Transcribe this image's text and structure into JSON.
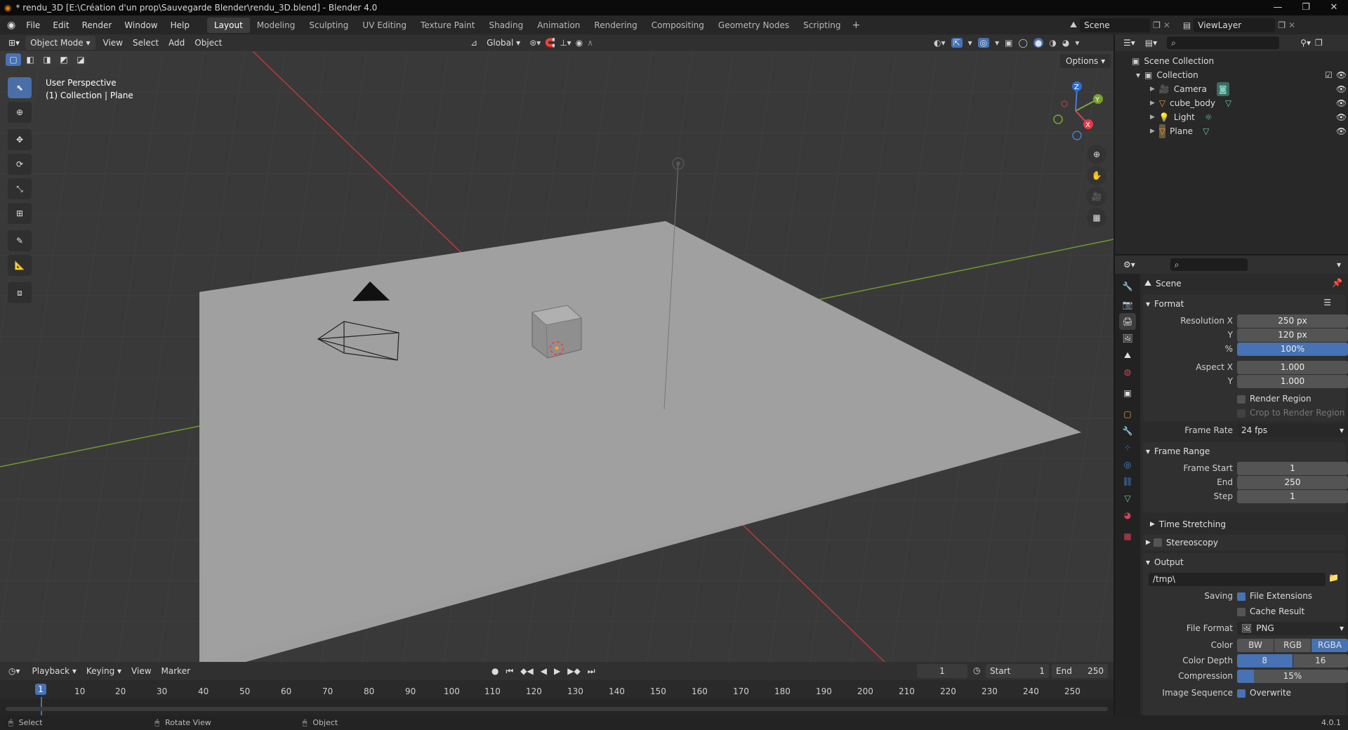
{
  "window": {
    "title": "* rendu_3D [E:\\Création d'un prop\\Sauvegarde Blender\\rendu_3D.blend] - Blender 4.0"
  },
  "topbar": {
    "menus": [
      "File",
      "Edit",
      "Render",
      "Window",
      "Help"
    ],
    "workspaces": [
      "Layout",
      "Modeling",
      "Sculpting",
      "UV Editing",
      "Texture Paint",
      "Shading",
      "Animation",
      "Rendering",
      "Compositing",
      "Geometry Nodes",
      "Scripting"
    ],
    "active_workspace": "Layout",
    "scene": "Scene",
    "view_layer": "ViewLayer"
  },
  "viewport_header": {
    "mode": "Object Mode",
    "menus": [
      "View",
      "Select",
      "Add",
      "Object"
    ],
    "orientation": "Global",
    "options": "Options"
  },
  "viewport": {
    "perspective": "User Perspective",
    "collection_info": "(1) Collection | Plane",
    "axes": {
      "z": "Z",
      "y": "Y",
      "x": "X"
    },
    "colors": {
      "x_axis": "#b83b3b",
      "y_axis": "#6e9b2d",
      "plane": "#9e9e9e",
      "bg": "#393939",
      "accent": "#4772b3"
    }
  },
  "timeline": {
    "menus": [
      "Playback",
      "Keying",
      "View",
      "Marker"
    ],
    "current_frame": "1",
    "start_label": "Start",
    "start": "1",
    "end_label": "End",
    "end": "250",
    "ruler": [
      "1",
      "10",
      "20",
      "30",
      "40",
      "50",
      "60",
      "70",
      "80",
      "90",
      "100",
      "110",
      "120",
      "130",
      "140",
      "150",
      "160",
      "170",
      "180",
      "190",
      "200",
      "210",
      "220",
      "230",
      "240",
      "250"
    ]
  },
  "statusbar": {
    "select": "Select",
    "rotate": "Rotate View",
    "object": "Object",
    "version": "4.0.1"
  },
  "outliner": {
    "root": "Scene Collection",
    "collection": "Collection",
    "items": [
      {
        "name": "Camera",
        "icon": "camera-icon"
      },
      {
        "name": "cube_body",
        "icon": "mesh-icon"
      },
      {
        "name": "Light",
        "icon": "light-icon"
      },
      {
        "name": "Plane",
        "icon": "mesh-icon"
      }
    ]
  },
  "properties": {
    "context": "Scene",
    "format": {
      "title": "Format",
      "resolution_x_label": "Resolution X",
      "resolution_x": "250 px",
      "y_label": "Y",
      "resolution_y": "120 px",
      "pct_label": "%",
      "pct": "100%",
      "aspect_x_label": "Aspect X",
      "aspect_x": "1.000",
      "aspect_y_label": "Y",
      "aspect_y": "1.000",
      "render_region": "Render Region",
      "crop": "Crop to Render Region",
      "frame_rate_label": "Frame Rate",
      "frame_rate": "24 fps"
    },
    "frame_range": {
      "title": "Frame Range",
      "start_label": "Frame Start",
      "start": "1",
      "end_label": "End",
      "end": "250",
      "step_label": "Step",
      "step": "1",
      "time_stretching": "Time Stretching"
    },
    "stereoscopy": "Stereoscopy",
    "output": {
      "title": "Output",
      "path": "/tmp\\",
      "saving_label": "Saving",
      "file_extensions": "File Extensions",
      "cache_result": "Cache Result",
      "file_format_label": "File Format",
      "file_format": "PNG",
      "color_label": "Color",
      "color_options": [
        "BW",
        "RGB",
        "RGBA"
      ],
      "color_selected": "RGBA",
      "depth_label": "Color Depth",
      "depth_options": [
        "8",
        "16"
      ],
      "depth_selected": "8",
      "compression_label": "Compression",
      "compression": "15%",
      "compression_value": 15,
      "image_sequence_label": "Image Sequence",
      "overwrite": "Overwrite"
    }
  }
}
